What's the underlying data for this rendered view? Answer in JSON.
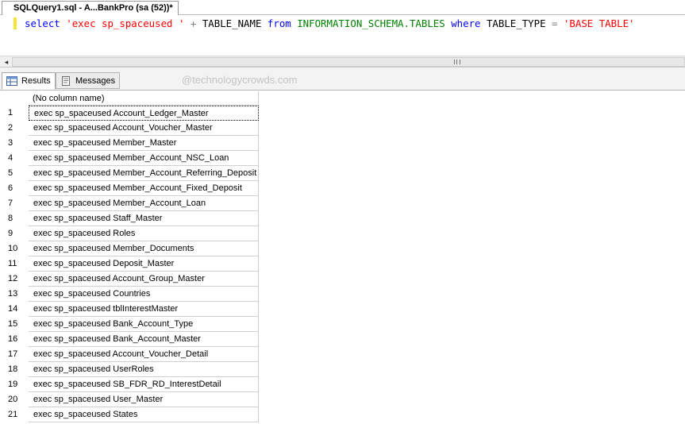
{
  "document_tab": {
    "title": "SQLQuery1.sql - A...BankPro (sa (52))*"
  },
  "editor": {
    "tokens": [
      {
        "text": "select",
        "kind": "kw"
      },
      {
        "text": " ",
        "kind": "ident"
      },
      {
        "text": "'exec sp_spaceused '",
        "kind": "str"
      },
      {
        "text": " + ",
        "kind": "op"
      },
      {
        "text": "TABLE_NAME",
        "kind": "ident"
      },
      {
        "text": " ",
        "kind": "ident"
      },
      {
        "text": "from",
        "kind": "kw"
      },
      {
        "text": " ",
        "kind": "ident"
      },
      {
        "text": "INFORMATION_SCHEMA.TABLES",
        "kind": "sys"
      },
      {
        "text": " ",
        "kind": "ident"
      },
      {
        "text": "where",
        "kind": "kw"
      },
      {
        "text": " TABLE_TYPE ",
        "kind": "ident"
      },
      {
        "text": "=",
        "kind": "op"
      },
      {
        "text": " ",
        "kind": "ident"
      },
      {
        "text": "'BASE TABLE'",
        "kind": "str"
      }
    ]
  },
  "scrollbar": {
    "left_arrow": "◂"
  },
  "results_tabs": {
    "results_label": "Results",
    "messages_label": "Messages"
  },
  "watermark": "@technologycrowds.com",
  "grid": {
    "column_header": "(No column name)",
    "rows": [
      {
        "num": "1",
        "value": "exec sp_spaceused Account_Ledger_Master"
      },
      {
        "num": "2",
        "value": "exec sp_spaceused Account_Voucher_Master"
      },
      {
        "num": "3",
        "value": "exec sp_spaceused Member_Master"
      },
      {
        "num": "4",
        "value": "exec sp_spaceused Member_Account_NSC_Loan"
      },
      {
        "num": "5",
        "value": "exec sp_spaceused Member_Account_Referring_Deposit"
      },
      {
        "num": "6",
        "value": "exec sp_spaceused Member_Account_Fixed_Deposit"
      },
      {
        "num": "7",
        "value": "exec sp_spaceused Member_Account_Loan"
      },
      {
        "num": "8",
        "value": "exec sp_spaceused Staff_Master"
      },
      {
        "num": "9",
        "value": "exec sp_spaceused Roles"
      },
      {
        "num": "10",
        "value": "exec sp_spaceused Member_Documents"
      },
      {
        "num": "11",
        "value": "exec sp_spaceused Deposit_Master"
      },
      {
        "num": "12",
        "value": "exec sp_spaceused Account_Group_Master"
      },
      {
        "num": "13",
        "value": "exec sp_spaceused Countries"
      },
      {
        "num": "14",
        "value": "exec sp_spaceused tblInterestMaster"
      },
      {
        "num": "15",
        "value": "exec sp_spaceused Bank_Account_Type"
      },
      {
        "num": "16",
        "value": "exec sp_spaceused Bank_Account_Master"
      },
      {
        "num": "17",
        "value": "exec sp_spaceused Account_Voucher_Detail"
      },
      {
        "num": "18",
        "value": "exec sp_spaceused UserRoles"
      },
      {
        "num": "19",
        "value": "exec sp_spaceused SB_FDR_RD_InterestDetail"
      },
      {
        "num": "20",
        "value": "exec sp_spaceused User_Master"
      },
      {
        "num": "21",
        "value": "exec sp_spaceused States"
      }
    ]
  }
}
